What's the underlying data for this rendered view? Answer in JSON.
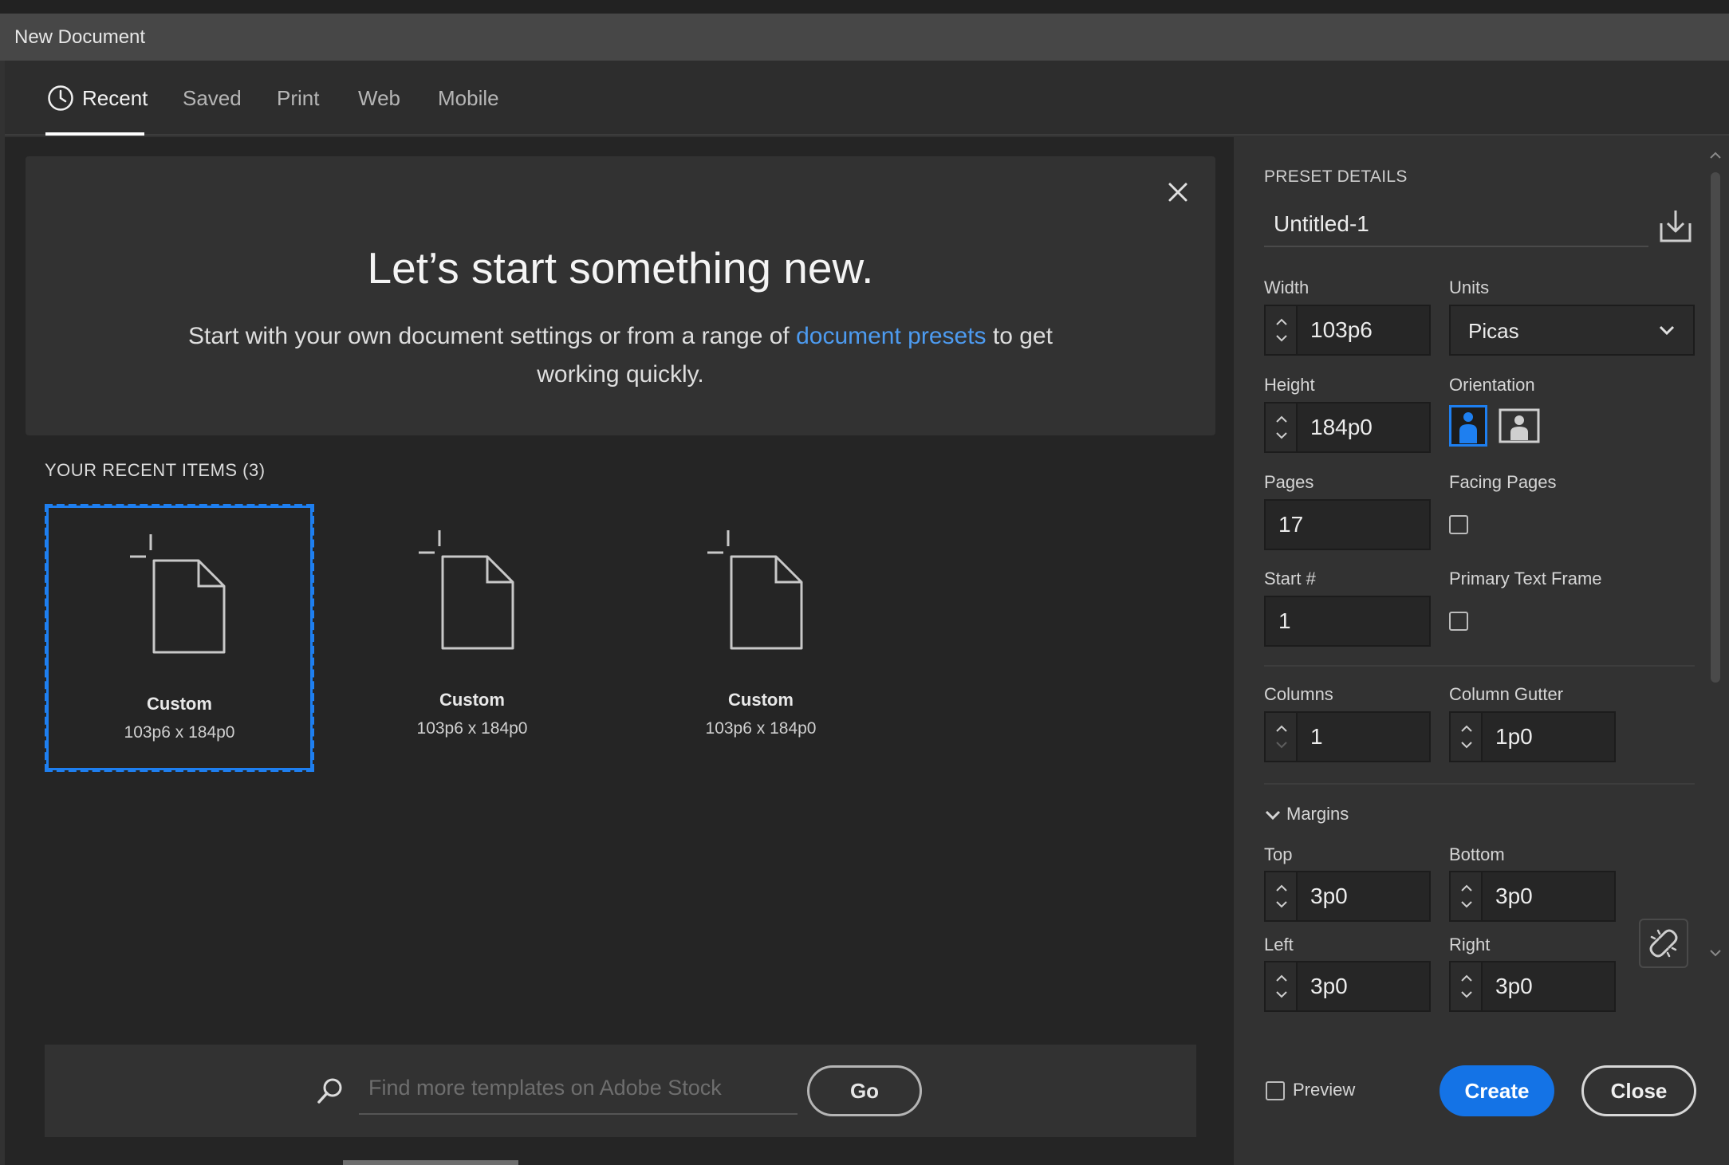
{
  "window": {
    "title": "New Document"
  },
  "tabs": [
    {
      "label": "Recent",
      "active": true
    },
    {
      "label": "Saved"
    },
    {
      "label": "Print"
    },
    {
      "label": "Web"
    },
    {
      "label": "Mobile"
    }
  ],
  "hero": {
    "title": "Let’s start something new.",
    "text_before": "Start with your own document settings or from a range of ",
    "link": "document presets",
    "text_after": " to get working quickly."
  },
  "recent": {
    "title": "YOUR RECENT ITEMS  (3)",
    "items": [
      {
        "name": "Custom",
        "size": "103p6 x 184p0",
        "selected": true
      },
      {
        "name": "Custom",
        "size": "103p6 x 184p0"
      },
      {
        "name": "Custom",
        "size": "103p6 x 184p0"
      }
    ]
  },
  "search": {
    "placeholder": "Find more templates on Adobe Stock",
    "go_label": "Go"
  },
  "preset": {
    "section_title": "PRESET DETAILS",
    "name": "Untitled-1",
    "width_label": "Width",
    "width": "103p6",
    "units_label": "Units",
    "units": "Picas",
    "height_label": "Height",
    "height": "184p0",
    "orientation_label": "Orientation",
    "orientation": "portrait",
    "pages_label": "Pages",
    "pages": "17",
    "facing_label": "Facing Pages",
    "facing": false,
    "start_label": "Start #",
    "start": "1",
    "ptf_label": "Primary Text Frame",
    "ptf": false,
    "columns_label": "Columns",
    "columns": "1",
    "gutter_label": "Column Gutter",
    "gutter": "1p0",
    "margins_label": "Margins",
    "top_label": "Top",
    "top": "3p0",
    "bottom_label": "Bottom",
    "bottom": "3p0",
    "left_label": "Left",
    "left": "3p0",
    "right_label": "Right",
    "right": "3p0",
    "preview_label": "Preview",
    "create_label": "Create",
    "close_label": "Close"
  },
  "colors": {
    "accent": "#1473e6",
    "link": "#4d9bf0",
    "selected_border": "#1e7ff0"
  }
}
